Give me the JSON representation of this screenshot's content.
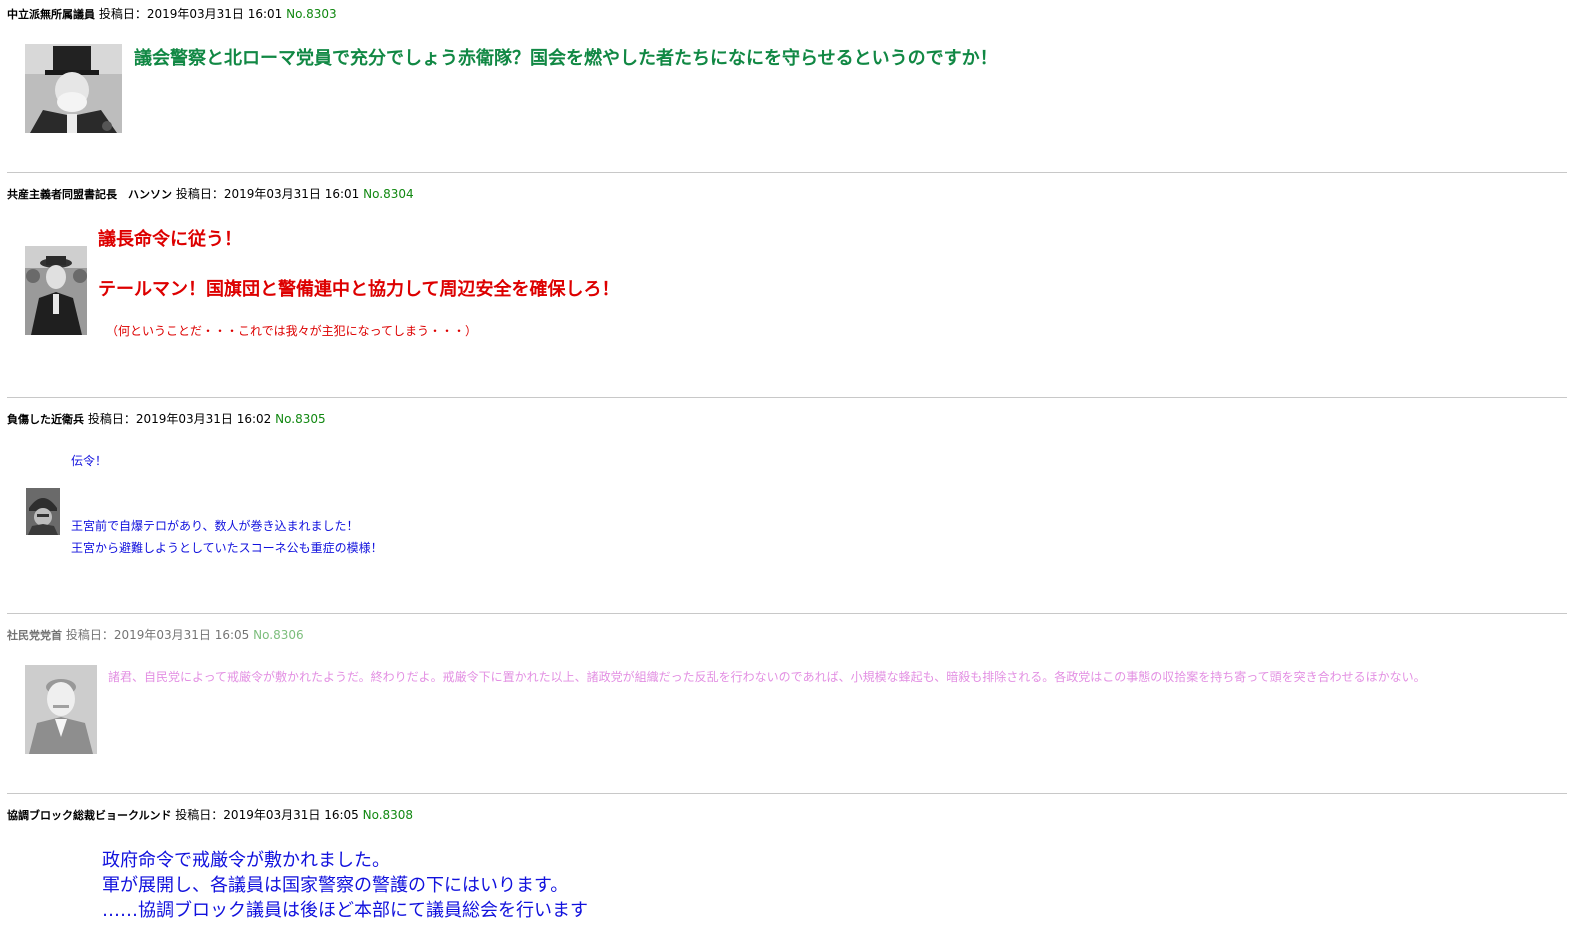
{
  "posts": [
    {
      "author": "中立派無所属議員",
      "date_label": "投稿日：",
      "date": "2019年03月31日 16:01",
      "no": "No.8303",
      "avatar_icon": "man-top-hat-avatar-icon",
      "lines": [
        "議会警察と北ローマ党員で充分でしょう赤衛隊？国会を燃やした者たちになにを守らせるというのですか！"
      ],
      "text_color": "#118844"
    },
    {
      "author": "共産主義者同盟書記長　ハンソン",
      "date_label": "投稿日：",
      "date": "2019年03月31日 16:01",
      "no": "No.8304",
      "avatar_icon": "man-hat-crowd-avatar-icon",
      "lines": [
        "議長命令に従う！",
        "テールマン！国旗団と警備連中と協力して周辺安全を確保しろ！",
        "（何ということだ・・・これでは我々が主犯になってしまう・・・）"
      ],
      "text_color": "#dd0000"
    },
    {
      "author": "負傷した近衛兵",
      "date_label": "投稿日：",
      "date": "2019年03月31日 16:02",
      "no": "No.8305",
      "avatar_icon": "soldier-helmet-avatar-icon",
      "lines": [
        "伝令！",
        "王宮前で自爆テロがあり、数人が巻き込まれました！",
        "王宮から避難しようとしていたスコーネ公も重症の模様！"
      ],
      "text_color": "#1111dd"
    },
    {
      "author": "社民党党首",
      "date_label": "投稿日：",
      "date": "2019年03月31日 16:05",
      "no": "No.8306",
      "avatar_icon": "man-suit-portrait-avatar-icon",
      "lines": [
        "諸君、自民党によって戒厳令が敷かれたようだ。終わりだよ。戒厳令下に置かれた以上、諸政党が組織だった反乱を行わないのであれば、小規模な蜂起も、暗殺も排除される。各政党はこの事態の収拾案を持ち寄って頭を突き合わせるほかない。"
      ],
      "text_color": "#dd55cc"
    },
    {
      "author": "協調ブロック総裁ビョークルンド",
      "date_label": "投稿日：",
      "date": "2019年03月31日 16:05",
      "no": "No.8308",
      "lines": [
        "政府命令で戒厳令が敷かれました。",
        "軍が展開し、各議員は国家警察の警護の下にはいります。",
        "……協調ブロック議員は後ほど本部にて議員総会を行います"
      ],
      "text_color": "#1111dd"
    }
  ]
}
